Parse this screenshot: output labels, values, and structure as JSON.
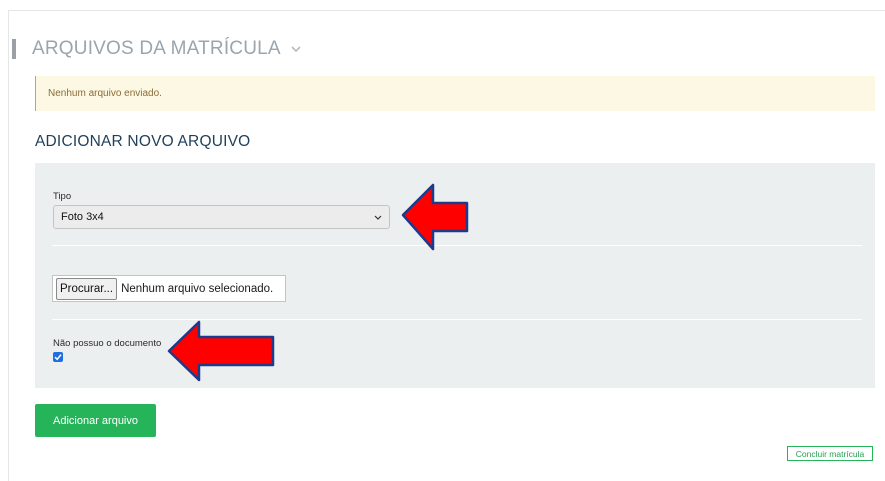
{
  "section": {
    "title": "ARQUIVOS DA MATRÍCULA",
    "collapse_icon": "chevron-down-icon"
  },
  "alert": {
    "message": "Nenhum arquivo enviado."
  },
  "add_file": {
    "title": "ADICIONAR NOVO ARQUIVO"
  },
  "form": {
    "type_label": "Tipo",
    "type_value": "Foto 3x4",
    "file_button": "Procurar...",
    "file_status": "Nenhum arquivo selecionado.",
    "no_document_label": "Não possuo o documento",
    "no_document_checked": true
  },
  "actions": {
    "add_file": "Adicionar arquivo",
    "finish": "Concluir matrícula"
  },
  "colors": {
    "primary_green": "#25b45a",
    "alert_bg": "#fcf8e3",
    "title_blue": "#1f3f5a",
    "annotation_arrow": "#ff0000"
  },
  "annotations": [
    {
      "icon": "red-arrow-icon",
      "direction": "left",
      "target": "type-select"
    },
    {
      "icon": "red-arrow-icon",
      "direction": "left",
      "target": "no-document-checkbox"
    }
  ]
}
